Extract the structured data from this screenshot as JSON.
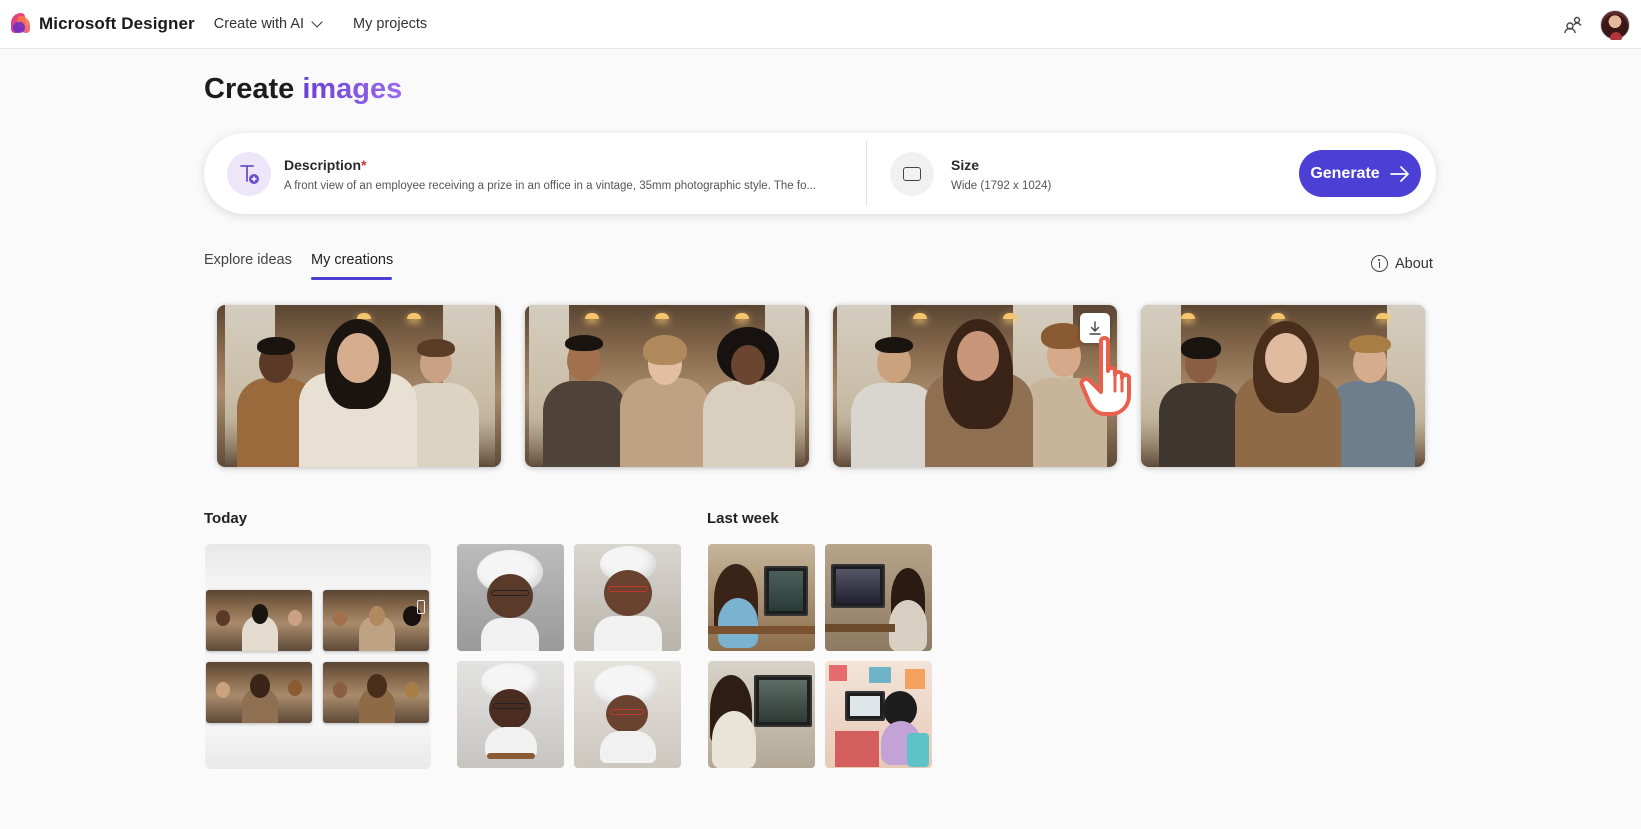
{
  "app": {
    "name": "Microsoft Designer",
    "nav": [
      {
        "label": "Create with AI",
        "has_dropdown": true
      },
      {
        "label": "My projects",
        "has_dropdown": false
      }
    ]
  },
  "page": {
    "title_part1": "Create ",
    "title_part2": "images"
  },
  "prompt": {
    "description_label": "Description",
    "description_required_mark": "*",
    "description_value": "A front view of an employee receiving a prize in an office in a vintage, 35mm photographic style. The fo...",
    "size_label": "Size",
    "size_value": "Wide (1792 x 1024)",
    "generate_label": "Generate"
  },
  "tabs": [
    {
      "label": "Explore ideas",
      "active": false
    },
    {
      "label": "My creations",
      "active": true
    }
  ],
  "about_label": "About",
  "results": [
    {
      "alt": "office team applauding 1"
    },
    {
      "alt": "office team applauding 2"
    },
    {
      "alt": "office team applauding 3"
    },
    {
      "alt": "office team applauding 4"
    }
  ],
  "groups": {
    "today": "Today",
    "last_week": "Last week"
  },
  "colors": {
    "accent": "#4c3fd6",
    "title_accent": "#7b52d6",
    "background": "#fafafa"
  }
}
